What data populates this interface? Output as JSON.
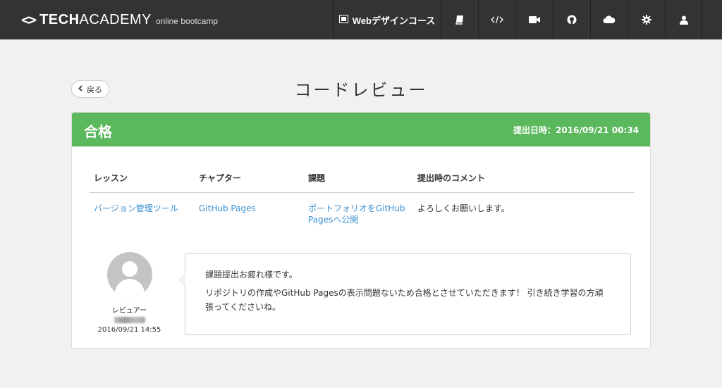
{
  "brand": {
    "mark": "<>",
    "tech": "TECH",
    "academy": "ACADEMY",
    "sub": "online bootcamp"
  },
  "nav": {
    "course_label": "Webデザインコース",
    "icons": [
      "book-icon",
      "code-icon",
      "video-icon",
      "github-icon",
      "cloud-icon",
      "gear-icon",
      "user-icon"
    ]
  },
  "page": {
    "back_label": "戻る",
    "title": "コードレビュー"
  },
  "result": {
    "status": "合格",
    "submitted": "提出日時：2016/09/21 00:34",
    "status_color": "#5cb85c"
  },
  "table": {
    "headers": [
      "レッスン",
      "チャプター",
      "課題",
      "提出時のコメント"
    ],
    "row": {
      "lesson": "バージョン管理ツール",
      "chapter": "GitHub Pages",
      "task": "ポートフォリオをGitHub Pagesへ公開",
      "comment": "よろしくお願いします。"
    }
  },
  "review": {
    "role": "レビュアー",
    "date": "2016/09/21 14:55",
    "paragraphs": [
      "課題提出お疲れ様です。",
      "リポジトリの作成やGitHub Pagesの表示問題ないため合格とさせていただきます！ 引き続き学習の方頑張ってくださいね。"
    ]
  }
}
